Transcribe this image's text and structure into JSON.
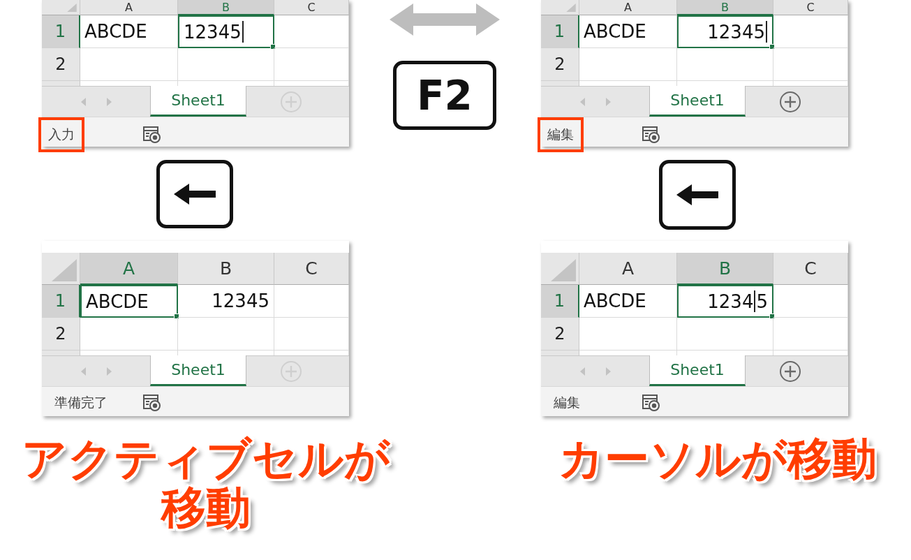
{
  "sheets": [
    {
      "columns": [
        {
          "label": "A",
          "selected": false
        },
        {
          "label": "B",
          "selected": true
        },
        {
          "label": "C",
          "selected": false
        }
      ],
      "rows": [
        {
          "label": "1",
          "selected": true,
          "cells": [
            {
              "text": "ABCDE",
              "right_aligned": false,
              "active": false,
              "kind": "static"
            },
            {
              "text": "12345",
              "right_aligned": false,
              "active": true,
              "kind": "trailing"
            }
          ]
        },
        {
          "label": "2",
          "selected": false
        }
      ],
      "sheet_tabs": [
        {
          "label": "Sheet1",
          "selected": true
        }
      ],
      "add_sheet_disabled": true,
      "status": {
        "text": "入力",
        "highlighted": true
      }
    },
    {
      "columns": [
        {
          "label": "A",
          "selected": false
        },
        {
          "label": "B",
          "selected": true
        },
        {
          "label": "C",
          "selected": false
        }
      ],
      "rows": [
        {
          "label": "1",
          "selected": true,
          "cells": [
            {
              "text": "ABCDE",
              "right_aligned": false,
              "active": false,
              "kind": "static"
            },
            {
              "text": "12345",
              "right_aligned": true,
              "active": true,
              "kind": "trailing"
            }
          ]
        },
        {
          "label": "2",
          "selected": false
        }
      ],
      "sheet_tabs": [
        {
          "label": "Sheet1",
          "selected": true
        }
      ],
      "add_sheet_disabled": false,
      "status": {
        "text": "編集",
        "highlighted": true
      }
    },
    {
      "columns": [
        {
          "label": "A",
          "selected": true
        },
        {
          "label": "B",
          "selected": false
        },
        {
          "label": "C",
          "selected": false
        }
      ],
      "rows": [
        {
          "label": "1",
          "selected": true,
          "cells": [
            {
              "text": "ABCDE",
              "right_aligned": false,
              "active": true,
              "kind": "static"
            },
            {
              "text": "12345",
              "right_aligned": true,
              "active": false,
              "kind": "static"
            }
          ]
        },
        {
          "label": "2",
          "selected": false
        }
      ],
      "sheet_tabs": [
        {
          "label": "Sheet1",
          "selected": true
        }
      ],
      "add_sheet_disabled": true,
      "status": {
        "text": "準備完了",
        "highlighted": false
      }
    },
    {
      "columns": [
        {
          "label": "A",
          "selected": false
        },
        {
          "label": "B",
          "selected": true
        },
        {
          "label": "C",
          "selected": false
        }
      ],
      "rows": [
        {
          "label": "1",
          "selected": true,
          "cells": [
            {
              "text": "ABCDE",
              "right_aligned": false,
              "active": false,
              "kind": "static"
            },
            {
              "text": "12345",
              "right_aligned": true,
              "active": true,
              "kind": "inner"
            }
          ]
        },
        {
          "label": "2",
          "selected": false
        }
      ],
      "sheet_tabs": [
        {
          "label": "Sheet1",
          "selected": true
        }
      ],
      "add_sheet_disabled": false,
      "status": {
        "text": "編集",
        "highlighted": false
      }
    }
  ],
  "f2_key": {
    "label": "F2"
  },
  "captions": [
    "アクティブセルが移動",
    "カーソルが移動"
  ]
}
